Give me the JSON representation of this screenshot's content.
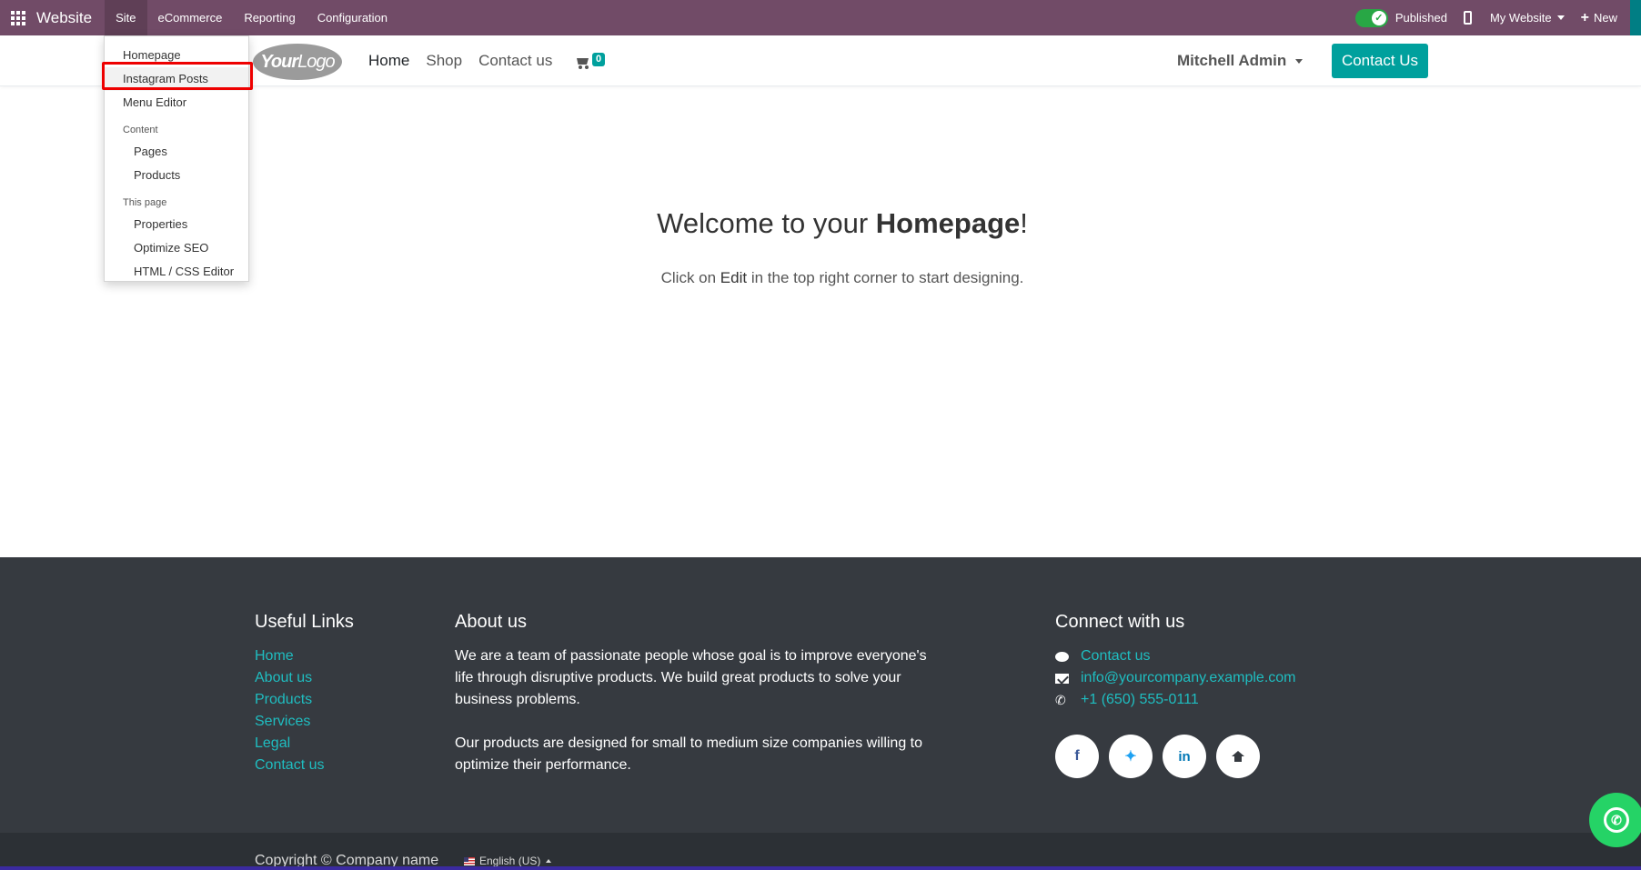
{
  "topbar": {
    "app_name": "Website",
    "menu": [
      "Site",
      "eCommerce",
      "Reporting",
      "Configuration"
    ],
    "published_label": "Published",
    "website_selector": "My Website",
    "new_label": "New",
    "accent": "#714b67"
  },
  "dropdown": {
    "items_top": [
      "Homepage",
      "Instagram Posts",
      "Menu Editor"
    ],
    "content_header": "Content",
    "content_items": [
      "Pages",
      "Products"
    ],
    "page_header": "This page",
    "page_items": [
      "Properties",
      "Optimize SEO",
      "HTML / CSS Editor"
    ]
  },
  "header": {
    "nav": [
      "Home",
      "Shop",
      "Contact us"
    ],
    "cart_count": "0",
    "user": "Mitchell Admin",
    "cta": "Contact Us",
    "brand_color": "#00a09d"
  },
  "main": {
    "welcome_prefix": "Welcome to your ",
    "welcome_bold": "Homepage",
    "welcome_suffix": "!",
    "hint_prefix": "Click on ",
    "hint_bold": "Edit",
    "hint_suffix": " in the top right corner to start designing."
  },
  "footer": {
    "useful_title": "Useful Links",
    "links": [
      "Home",
      "About us",
      "Products",
      "Services",
      "Legal",
      "Contact us"
    ],
    "about_title": "About us",
    "about_p1": "We are a team of passionate people whose goal is to improve everyone's life through disruptive products. We build great products to solve your business problems.",
    "about_p2": "Our products are designed for small to medium size companies willing to optimize their performance.",
    "connect_title": "Connect with us",
    "contact_link": "Contact us",
    "email": "info@yourcompany.example.com",
    "phone": "+1 (650) 555-0111",
    "socials": [
      "facebook-icon",
      "twitter-icon",
      "linkedin-icon",
      "home-icon"
    ],
    "copyright": "Copyright © Company name",
    "language": "English (US)"
  }
}
